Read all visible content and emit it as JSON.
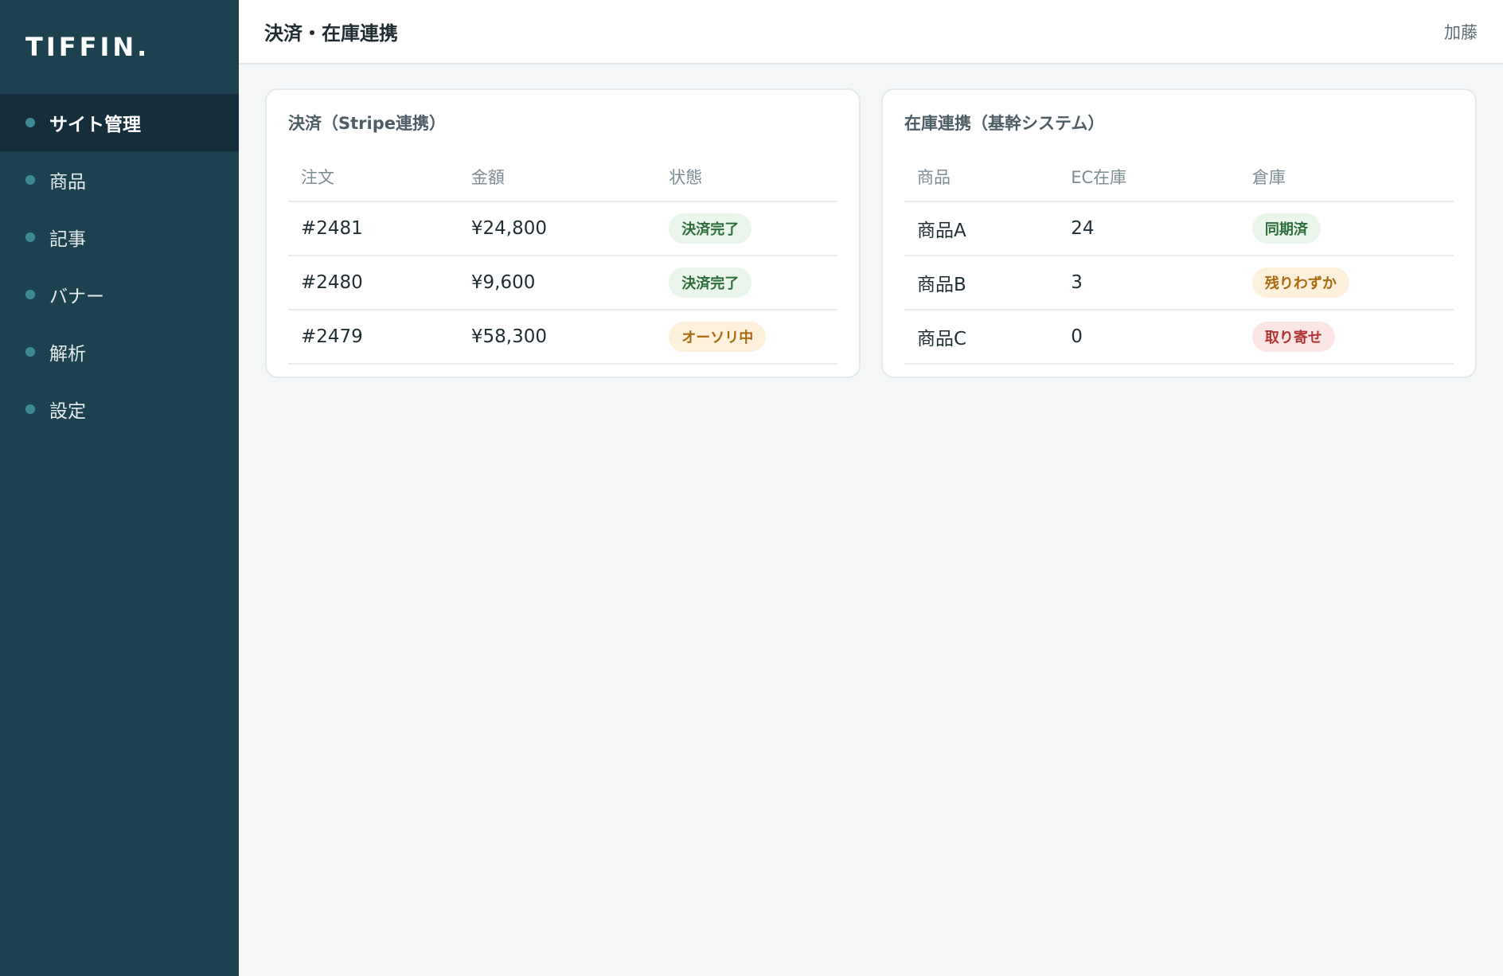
{
  "sidebar": {
    "logo": "TIFFIN.",
    "items": [
      {
        "label": "サイト管理",
        "active": true
      },
      {
        "label": "商品"
      },
      {
        "label": "記事"
      },
      {
        "label": "バナー"
      },
      {
        "label": "解析"
      },
      {
        "label": "設定"
      }
    ]
  },
  "header": {
    "title": "決済・在庫連携",
    "user": "加藤"
  },
  "payments": {
    "title": "決済（Stripe連携）",
    "columns": [
      "注文",
      "金額",
      "状態"
    ],
    "rows": [
      {
        "order": "#2481",
        "amount": "¥24,800",
        "status": "決済完了",
        "status_color": "#2c6e3a"
      },
      {
        "order": "#2480",
        "amount": "¥9,600",
        "status": "決済完了",
        "status_color": "#2c6e3a"
      },
      {
        "order": "#2479",
        "amount": "¥58,300",
        "status": "オーソリ中",
        "status_color": "#a86a10"
      }
    ]
  },
  "inventory": {
    "title": "在庫連携（基幹システム）",
    "columns": [
      "商品",
      "EC在庫",
      "倉庫"
    ],
    "rows": [
      {
        "product": "商品A",
        "stock": "24",
        "warehouse": "同期済",
        "status_color": "#2c6e3a"
      },
      {
        "product": "商品B",
        "stock": "3",
        "warehouse": "残りわずか",
        "status_color": "#a86a10"
      },
      {
        "product": "商品C",
        "stock": "0",
        "warehouse": "取り寄せ",
        "status_color": "#b23434"
      }
    ]
  },
  "colors": {
    "sidebar_bg": "#1c4250",
    "sidebar_active_bg": "#142f3b",
    "accent_dot": "#3f8a92",
    "success": "#2c6e3a",
    "warning": "#a86a10",
    "danger": "#b23434"
  }
}
